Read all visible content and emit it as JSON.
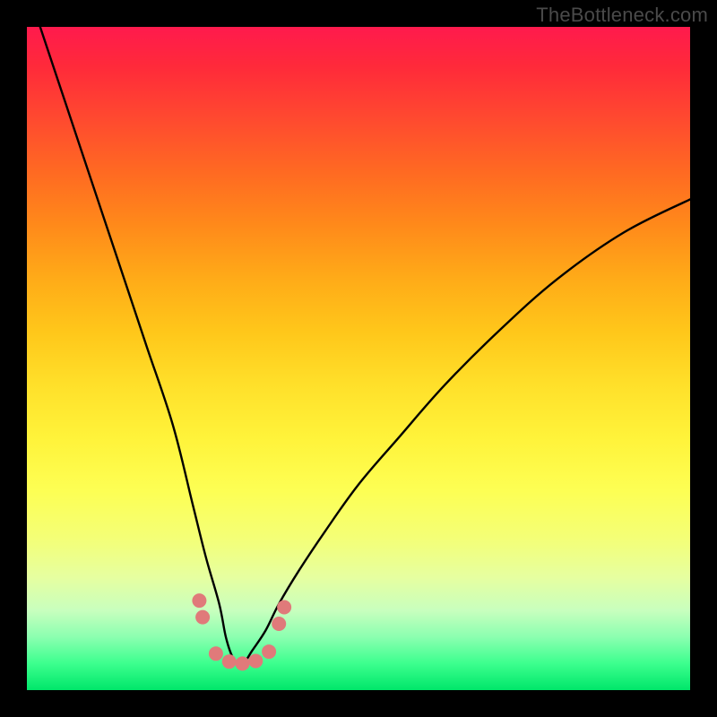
{
  "attribution": "TheBottleneck.com",
  "colors": {
    "frame": "#000000",
    "curve_stroke": "#000000",
    "marker_fill": "#e07a7a",
    "marker_stroke": "#d46a6a"
  },
  "chart_data": {
    "type": "line",
    "title": "",
    "xlabel": "",
    "ylabel": "",
    "xlim": [
      0,
      100
    ],
    "ylim": [
      0,
      100
    ],
    "grid": false,
    "note": "Axes have no visible tick labels; x and y values are normalized 0–100 estimates read from pixel positions. y=0 is the bottom (green) edge, y=100 is the top (red) edge. The curve is a V/valley shape with its minimum near x≈32.",
    "series": [
      {
        "name": "bottleneck-curve",
        "x": [
          2,
          6,
          10,
          14,
          18,
          22,
          25,
          27,
          29,
          30,
          31,
          32,
          33,
          34,
          36,
          38,
          41,
          45,
          50,
          56,
          63,
          71,
          80,
          90,
          100
        ],
        "y": [
          100,
          88,
          76,
          64,
          52,
          40,
          28,
          20,
          13,
          8,
          5,
          4,
          4.5,
          6,
          9,
          13,
          18,
          24,
          31,
          38,
          46,
          54,
          62,
          69,
          74
        ]
      }
    ],
    "markers": {
      "name": "highlight-points",
      "comment": "Small salmon dots clustered near valley bottom on both flanks.",
      "points": [
        {
          "x": 26.0,
          "y": 13.5
        },
        {
          "x": 26.5,
          "y": 11.0
        },
        {
          "x": 28.5,
          "y": 5.5
        },
        {
          "x": 30.5,
          "y": 4.3
        },
        {
          "x": 32.5,
          "y": 4.0
        },
        {
          "x": 34.5,
          "y": 4.4
        },
        {
          "x": 36.5,
          "y": 5.8
        },
        {
          "x": 38.0,
          "y": 10.0
        },
        {
          "x": 38.8,
          "y": 12.5
        }
      ]
    }
  }
}
